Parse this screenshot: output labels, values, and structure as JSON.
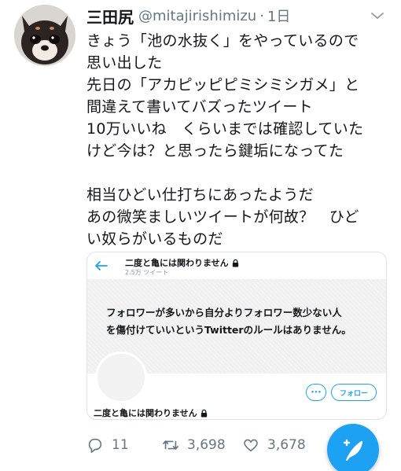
{
  "tweet": {
    "display_name": "三田尻",
    "handle": "@mitajirishimizu",
    "separator": "·",
    "time": "1日",
    "text_lines": [
      "きょう「池の水抜く」をやっているので",
      "思い出した",
      "先日の「アカピッピピミシミシガメ」と",
      "間違えて書いてバズったツイート",
      "10万いいね　くらいまでは確認していた",
      "けど今は？と思ったら鍵垢になってた",
      "",
      "相当ひどい仕打ちにあったようだ",
      "あの微笑ましいツイートが何故？　ひど",
      "い奴らがいるものだ"
    ],
    "icons": {
      "avatar": "chihuahua-avatar",
      "menu": "chevron-down-icon"
    }
  },
  "card": {
    "title": "二度と亀には関わりません",
    "subtitle": "2.5万 ツイート",
    "banner_lines": [
      "フォロワーが多いから自分よりフォロワー数少ない人",
      "を傷付けていいというTwitterのルールはありません。"
    ],
    "more_label": "•••",
    "follow_label": "フォロー",
    "profile_name": "二度と亀には関わりません"
  },
  "actions": {
    "reply_count": "11",
    "retweet_count": "3,698",
    "like_count": "3,678"
  },
  "colors": {
    "accent": "#1da1f2",
    "secondary_text": "#657786",
    "primary_text": "#14171a"
  }
}
